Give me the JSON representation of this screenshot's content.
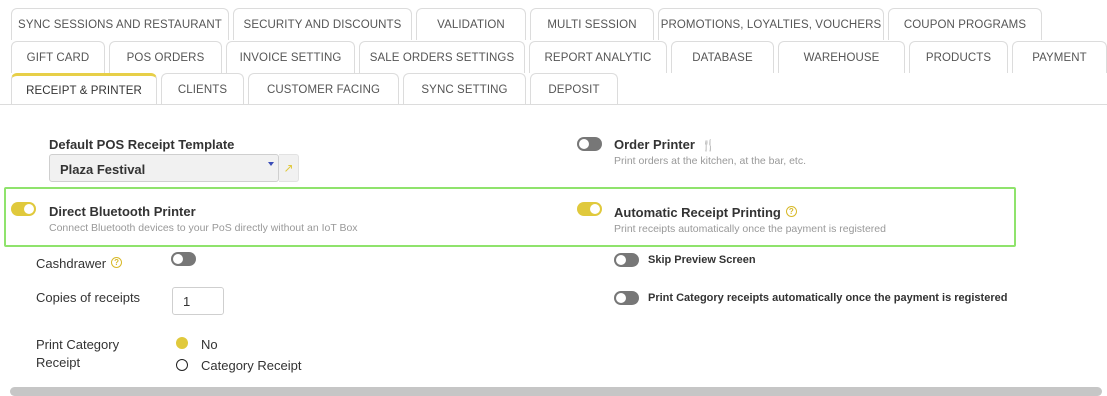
{
  "tabs": {
    "row1": [
      "SYNC SESSIONS AND RESTAURANT",
      "SECURITY AND DISCOUNTS",
      "VALIDATION",
      "MULTI SESSION",
      "PROMOTIONS, LOYALTIES, VOUCHERS",
      "COUPON PROGRAMS"
    ],
    "row2": [
      "GIFT CARD",
      "POS ORDERS",
      "INVOICE SETTING",
      "SALE ORDERS SETTINGS",
      "REPORT ANALYTIC",
      "DATABASE",
      "WAREHOUSE",
      "PRODUCTS",
      "PAYMENT"
    ],
    "row3": [
      "RECEIPT & PRINTER",
      "CLIENTS",
      "CUSTOMER FACING",
      "SYNC SETTING",
      "DEPOSIT"
    ],
    "active": "RECEIPT & PRINTER"
  },
  "receipt_template": {
    "label": "Default POS Receipt Template",
    "value": "Plaza Festival"
  },
  "order_printer": {
    "label": "Order Printer",
    "description": "Print orders at the kitchen, at the bar, etc.",
    "enabled": false
  },
  "direct_bluetooth": {
    "label": "Direct Bluetooth Printer",
    "description": "Connect Bluetooth devices to your PoS directly without an IoT Box",
    "enabled": true
  },
  "auto_receipt": {
    "label": "Automatic Receipt Printing",
    "description": "Print receipts automatically once the payment is registered",
    "enabled": true
  },
  "cashdrawer": {
    "label": "Cashdrawer",
    "enabled": false
  },
  "skip_preview": {
    "label": "Skip Preview Screen",
    "enabled": false
  },
  "copies": {
    "label": "Copies of receipts",
    "value": "1"
  },
  "print_category_auto": {
    "label": "Print Category receipts automatically once the payment is registered",
    "enabled": false
  },
  "print_category_receipt": {
    "label_line1": "Print Category",
    "label_line2": "Receipt",
    "options": [
      "No",
      "Category Receipt"
    ],
    "selected": "No"
  },
  "colors": {
    "accent": "#e0c93c",
    "highlight": "#8fe36c"
  }
}
